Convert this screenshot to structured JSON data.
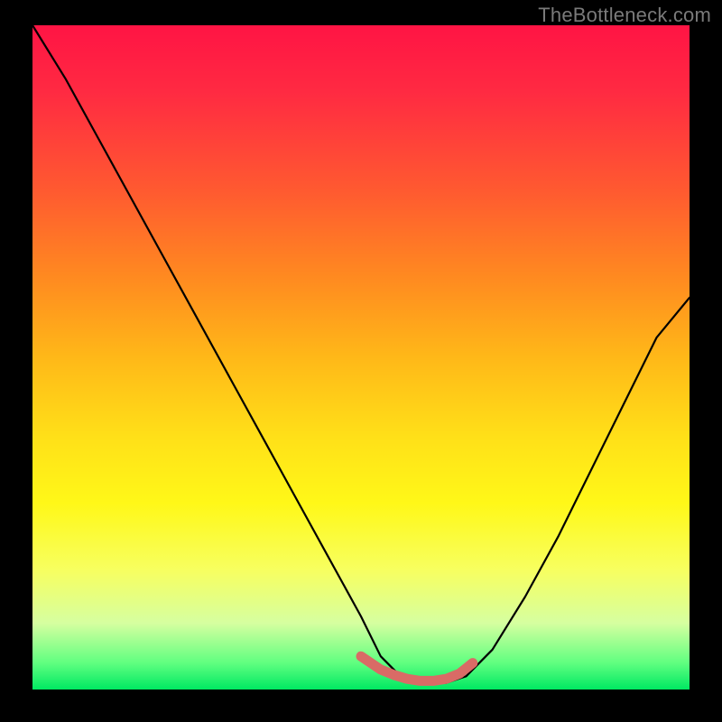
{
  "watermark": "TheBottleneck.com",
  "chart_data": {
    "type": "line",
    "title": "",
    "xlabel": "",
    "ylabel": "",
    "xlim": [
      0,
      100
    ],
    "ylim": [
      0,
      100
    ],
    "series": [
      {
        "name": "bottleneck-curve",
        "x": [
          0,
          5,
          10,
          15,
          20,
          25,
          30,
          35,
          40,
          45,
          50,
          53,
          56,
          60,
          63,
          66,
          70,
          75,
          80,
          85,
          90,
          95,
          100
        ],
        "y": [
          100,
          92,
          83,
          74,
          65,
          56,
          47,
          38,
          29,
          20,
          11,
          5,
          2,
          1,
          1,
          2,
          6,
          14,
          23,
          33,
          43,
          53,
          59
        ]
      }
    ],
    "highlight": {
      "name": "flat-region",
      "color": "#d96b66",
      "x": [
        50,
        53,
        55,
        57,
        59,
        61,
        63,
        65,
        67
      ],
      "y": [
        5,
        3,
        2.2,
        1.6,
        1.3,
        1.3,
        1.6,
        2.4,
        4
      ]
    },
    "colors": {
      "curve": "#000000",
      "highlight": "#d96b66",
      "frame": "#000000"
    }
  }
}
